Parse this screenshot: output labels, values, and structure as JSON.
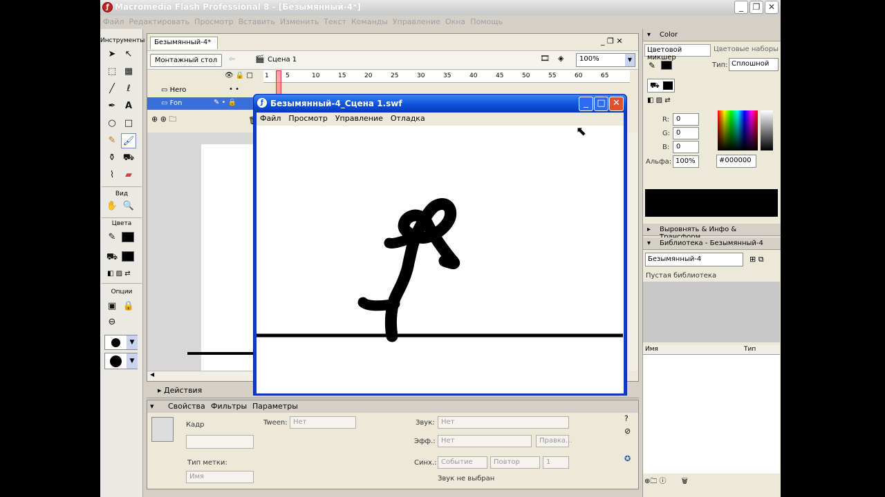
{
  "window": {
    "title": "Macromedia Flash Professional 8 - [Безымянный-4*]"
  },
  "menu": [
    "Файл",
    "Редактировать",
    "Просмотр",
    "Вставить",
    "Изменить",
    "Текст",
    "Команды",
    "Управление",
    "Окна",
    "Помощь"
  ],
  "toolbox": {
    "header": "Инструменты",
    "view_label": "Вид",
    "colors_label": "Цвета",
    "options_label": "Опции"
  },
  "document": {
    "tab": "Безымянный-4*",
    "timeline_button": "Монтажный стол",
    "scene": "Сцена 1",
    "zoom": "100%",
    "frame_numbers": [
      "1",
      "5",
      "10",
      "15",
      "20",
      "25",
      "30",
      "35",
      "40",
      "45",
      "50",
      "55",
      "60",
      "65"
    ],
    "layers": [
      {
        "name": "Hero"
      },
      {
        "name": "Fon"
      }
    ]
  },
  "actions_panel": {
    "label": "Действия"
  },
  "properties": {
    "tabs": [
      "Свойства",
      "Фильтры",
      "Параметры"
    ],
    "frame_label": "Кадр",
    "label_type_label": "Тип метки:",
    "label_type_value": "Имя",
    "tween_label": "Tween:",
    "tween_value": "Нет",
    "sound_label": "Звук:",
    "sound_value": "Нет",
    "effect_label": "Эфф.:",
    "effect_value": "Нет",
    "edit_button": "Правка...",
    "sync_label": "Синх.:",
    "sync_value": "Событие",
    "repeat_value": "Повтор",
    "repeat_count": "1",
    "no_sound": "Звук не выбран"
  },
  "color_panel": {
    "title": "Color",
    "tab_mixer": "Цветовой микшер",
    "tab_swatches": "Цветовые наборы",
    "type_label": "Тип:",
    "type_value": "Сплошной",
    "r_label": "R:",
    "r": "0",
    "g_label": "G:",
    "g": "0",
    "b_label": "B:",
    "b": "0",
    "alpha_label": "Альфа:",
    "alpha": "100%",
    "hex": "#000000"
  },
  "align_panel": {
    "title": "Выровнять & Инфо & Трансформ..."
  },
  "library_panel": {
    "title": "Библиотека - Безымянный-4",
    "doc_select": "Безымянный-4",
    "empty_text": "Пустая библиотека",
    "col_name": "Имя",
    "col_type": "Тип"
  },
  "swf_window": {
    "title": "Безымянный-4_Сцена 1.swf",
    "menu": [
      "Файл",
      "Просмотр",
      "Управление",
      "Отладка"
    ]
  },
  "colors": {
    "xp_blue": "#0a4ed8",
    "flash_red": "#c62020",
    "stroke": "#000000"
  }
}
